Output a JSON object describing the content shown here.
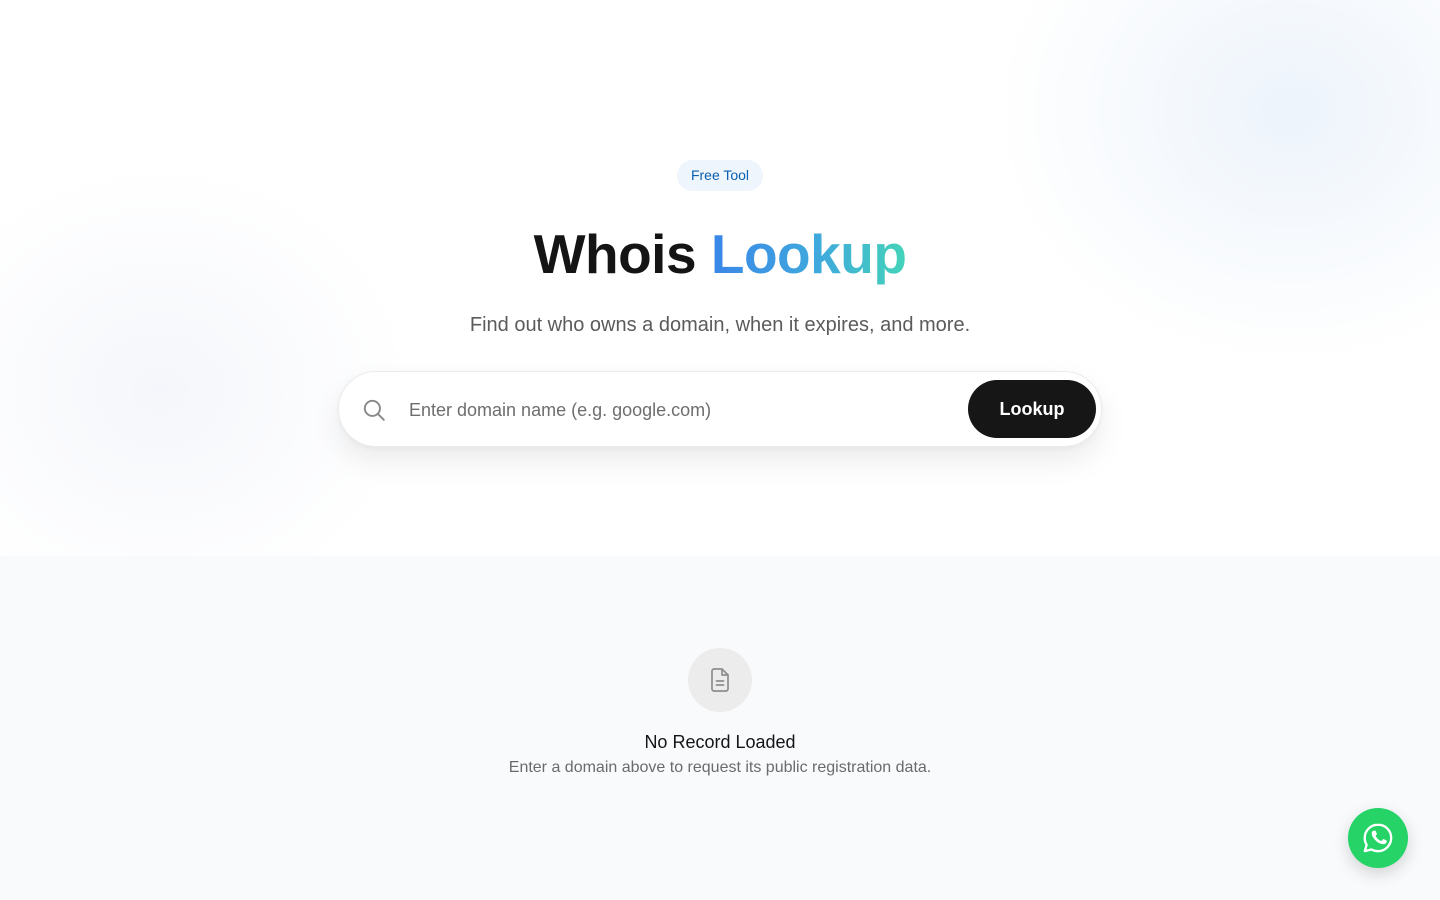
{
  "hero": {
    "badge": "Free Tool",
    "title_part1": "Whois",
    "title_part2": "Lookup",
    "subtitle": "Find out who owns a domain, when it expires, and more."
  },
  "search": {
    "placeholder": "Enter domain name (e.g. google.com)",
    "value": "",
    "button_label": "Lookup",
    "icon": "search-icon"
  },
  "empty_state": {
    "icon": "document-icon",
    "title": "No Record Loaded",
    "description": "Enter a domain above to request its public registration data."
  },
  "floating": {
    "icon": "whatsapp-icon"
  },
  "colors": {
    "accent_gradient_start": "#3a86e8",
    "accent_gradient_end": "#44d3b9",
    "button_bg": "#161616",
    "badge_bg": "#eef5fc",
    "badge_text": "#0b5fb0",
    "whatsapp_green": "#25d366"
  }
}
